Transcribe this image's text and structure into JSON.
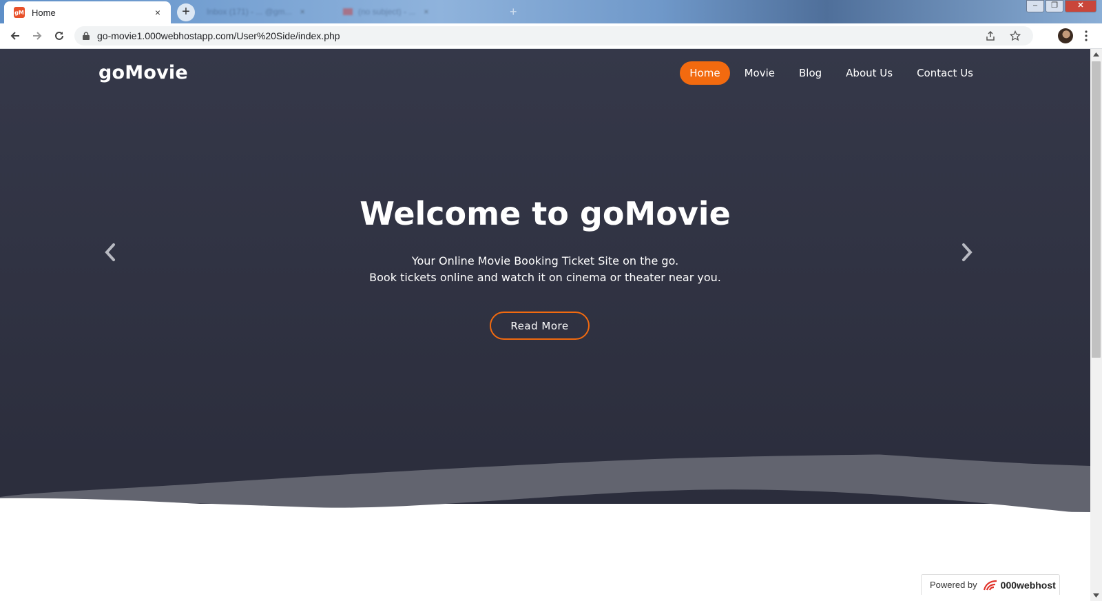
{
  "browser": {
    "active_tab": {
      "title": "Home",
      "favicon_text": "gM"
    },
    "other_tabs": [
      {
        "title": "Inbox (171) - ... @gm..."
      },
      {
        "title": "(no subject) - ..."
      }
    ],
    "url": "go-movie1.000webhostapp.com/User%20Side/index.php",
    "window_controls": {
      "minimize": "–",
      "maximize": "❐",
      "close": "✕"
    },
    "new_tab_label": "+",
    "tab_close_label": "×"
  },
  "site": {
    "brand": "goMovie",
    "nav": [
      {
        "label": "Home",
        "active": true
      },
      {
        "label": "Movie",
        "active": false
      },
      {
        "label": "Blog",
        "active": false
      },
      {
        "label": "About Us",
        "active": false
      },
      {
        "label": "Contact Us",
        "active": false
      }
    ],
    "hero": {
      "title": "Welcome to goMovie",
      "subtitle_line1": "Your Online Movie Booking Ticket Site on the go.",
      "subtitle_line2": "Book tickets online and watch it on cinema or theater near you.",
      "cta": "Read More"
    },
    "powered_by": {
      "label": "Powered by",
      "host": "000webhost"
    }
  },
  "colors": {
    "accent": "#f26a0f",
    "hero_bg": "#2f3142",
    "wave": "#62646f"
  },
  "icons": [
    "back-arrow-icon",
    "forward-arrow-icon",
    "reload-icon",
    "lock-icon",
    "share-icon",
    "star-icon",
    "kebab-menu-icon",
    "chevron-left-icon",
    "chevron-right-icon"
  ]
}
